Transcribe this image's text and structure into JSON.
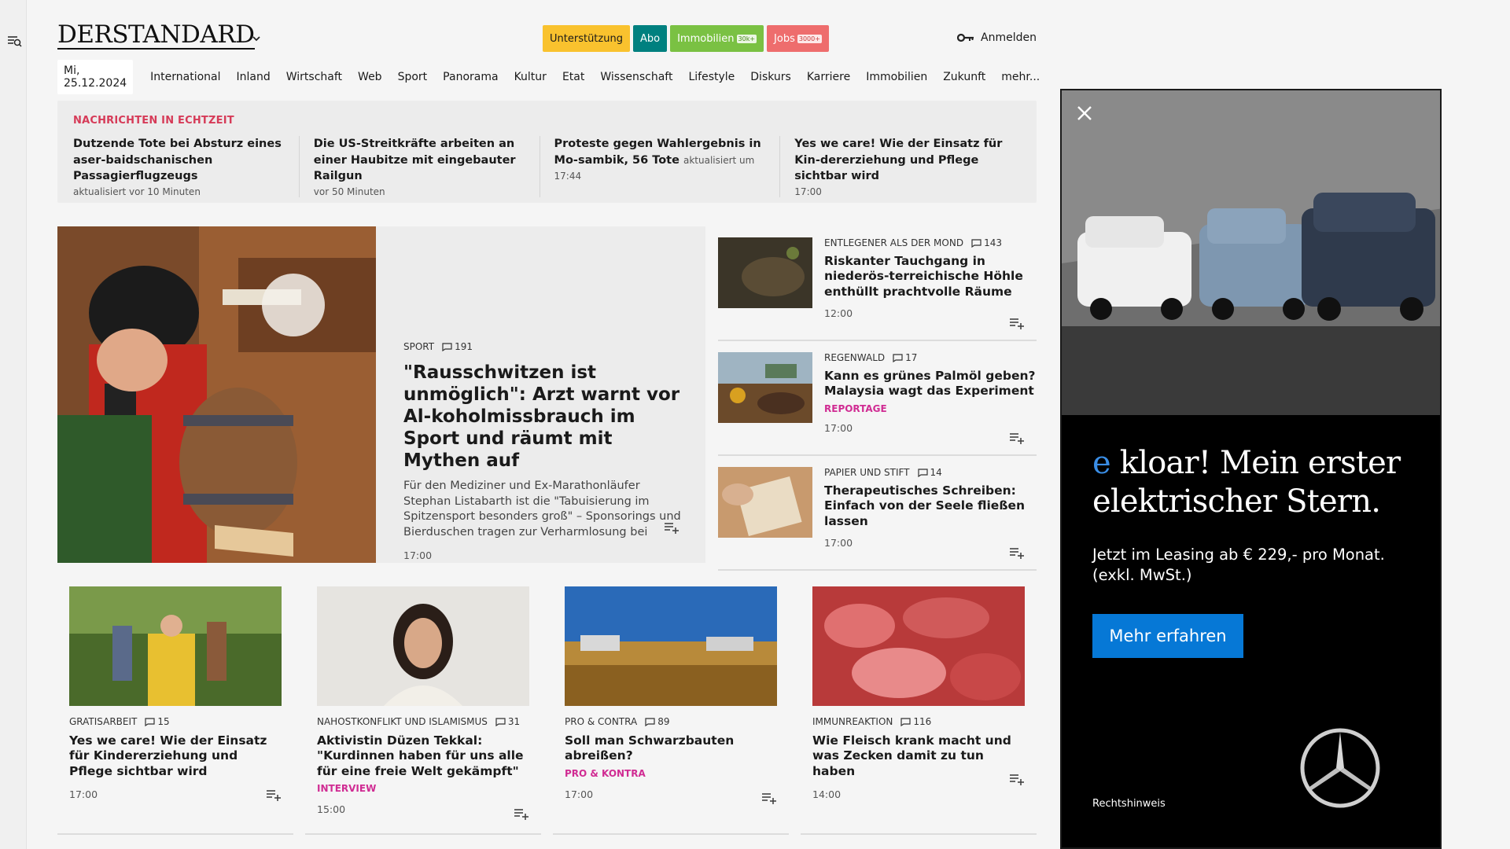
{
  "header": {
    "logo": "DERSTANDARD",
    "buttons": {
      "support": "Unterstützung",
      "abo": "Abo",
      "immobilien": "Immobilien",
      "immobilien_badge": "30k+",
      "jobs": "Jobs",
      "jobs_badge": "3000+"
    },
    "login": "Anmelden"
  },
  "nav": {
    "date": "Mi, 25.12.2024",
    "items": [
      "International",
      "Inland",
      "Wirtschaft",
      "Web",
      "Sport",
      "Panorama",
      "Kultur",
      "Etat",
      "Wissenschaft",
      "Lifestyle",
      "Diskurs",
      "Karriere",
      "Immobilien",
      "Zukunft",
      "mehr..."
    ]
  },
  "live": {
    "title": "NACHRICHTEN IN ECHTZEIT",
    "items": [
      {
        "title": "Dutzende Tote bei Absturz eines aser-baidschanischen Passagierflugzeugs",
        "meta": "aktualisiert vor 10 Minuten"
      },
      {
        "title": "Die US-Streitkräfte arbeiten an einer Haubitze mit eingebauter Railgun",
        "meta": "vor 50 Minuten"
      },
      {
        "title": "Proteste gegen Wahlergebnis in Mo-sambik, 56 Tote",
        "meta": "aktualisiert um 17:44"
      },
      {
        "title": "Yes we care! Wie der Einsatz für Kin-dererziehung und Pflege sichtbar wird",
        "meta": "17:00"
      }
    ]
  },
  "hero": {
    "kicker": "SPORT",
    "comments": "191",
    "title": "\"Rausschwitzen ist unmöglich\": Arzt warnt vor Al-koholmissbrauch im Sport und räumt mit Mythen auf",
    "teaser": "Für den Mediziner und Ex-Marathonläufer Stephan Listabarth ist die \"Tabuisierung im Spitzensport besonders groß\" – Sponsorings und Bierduschen tragen zur Verharmlosung bei",
    "time": "17:00"
  },
  "side": [
    {
      "kicker": "ENTLEGENER ALS DER MOND",
      "comments": "143",
      "title": "Riskanter Tauchgang in niederös-terreichische Höhle enthüllt prachtvolle Räume",
      "tag": "",
      "time": "12:00"
    },
    {
      "kicker": "REGENWALD",
      "comments": "17",
      "title": "Kann es grünes Palmöl geben? Malaysia wagt das Experiment",
      "tag": "REPORTAGE",
      "time": "17:00"
    },
    {
      "kicker": "PAPIER UND STIFT",
      "comments": "14",
      "title": "Therapeutisches Schreiben: Einfach von der Seele fließen lassen",
      "tag": "",
      "time": "17:00"
    }
  ],
  "cards": [
    {
      "kicker": "GRATISARBEIT",
      "comments": "15",
      "title": "Yes we care! Wie der Einsatz für Kindererziehung und Pflege sichtbar wird",
      "tag": "",
      "time": "17:00"
    },
    {
      "kicker": "NAHOSTKONFLIKT UND ISLAMISMUS",
      "comments": "31",
      "title": "Aktivistin Düzen Tekkal: \"Kurdinnen haben für uns alle für eine freie Welt gekämpft\"",
      "tag": "INTERVIEW",
      "time": "15:00"
    },
    {
      "kicker": "PRO & CONTRA",
      "comments": "89",
      "title": "Soll man Schwarzbauten abreißen?",
      "tag": "PRO & KONTRA",
      "time": "17:00"
    },
    {
      "kicker": "IMMUNREAKTION",
      "comments": "116",
      "title": "Wie Fleisch krank macht und was Zecken damit zu tun haben",
      "tag": "",
      "time": "14:00"
    }
  ],
  "ad": {
    "headline_e": "e",
    "headline": " kloar! Mein erster elektrischer Stern.",
    "sub": "Jetzt im Leasing ab € 229,- pro Monat. (exkl. MwSt.)",
    "button": "Mehr erfahren",
    "legal": "Rechtshinweis"
  },
  "colors": {
    "support": "#f9c22e",
    "abo": "#00807f",
    "immobilien": "#7ac143",
    "jobs": "#ee6d6d",
    "live_title": "#d63b58",
    "tag": "#d02c93",
    "ad_button": "#0678d6"
  },
  "icons": [
    "search-menu-icon",
    "chevron-down-icon",
    "key-icon",
    "comment-icon",
    "add-to-list-icon",
    "close-icon",
    "mercedes-star-icon"
  ]
}
